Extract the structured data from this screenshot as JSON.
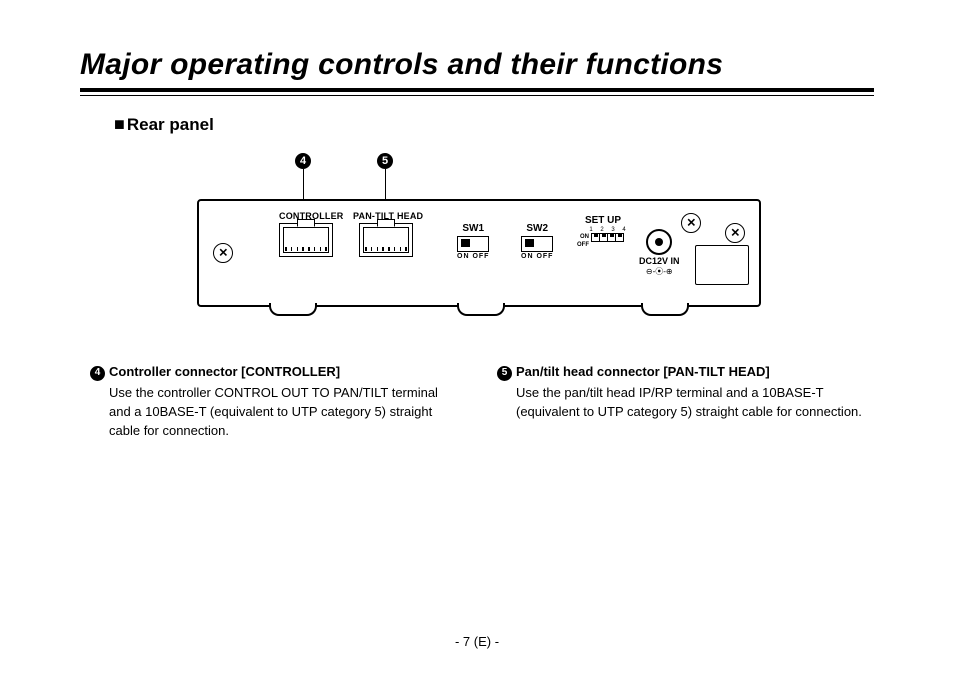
{
  "title": "Major operating controls and their functions",
  "subhead_bullet": "■",
  "subhead": "Rear panel",
  "callouts": {
    "c4": "4",
    "c5": "5"
  },
  "panel": {
    "controller_label": "CONTROLLER",
    "pantilt_label": "PAN-TILT HEAD",
    "sw1_label": "SW1",
    "sw2_label": "SW2",
    "sw_on": "ON",
    "sw_off": "OFF",
    "sw_onoff": "ON   OFF",
    "setup_label": "SET UP",
    "dip_nums": "1 2 3 4",
    "dip_on": "ON",
    "dip_off": "OFF",
    "dc_label": "DC12V IN",
    "dc_polarity": "⊖-⦿-⊕"
  },
  "desc4": {
    "num": "4",
    "title": "Controller connector [CONTROLLER]",
    "body": "Use the controller CONTROL OUT TO PAN/TILT terminal and a 10BASE-T (equivalent to UTP category 5) straight cable for connection."
  },
  "desc5": {
    "num": "5",
    "title": "Pan/tilt head connector [PAN-TILT HEAD]",
    "body": "Use the pan/tilt head IP/RP terminal and a 10BASE-T (equivalent to UTP category 5) straight cable for connection."
  },
  "page_number": "- 7 (E) -"
}
